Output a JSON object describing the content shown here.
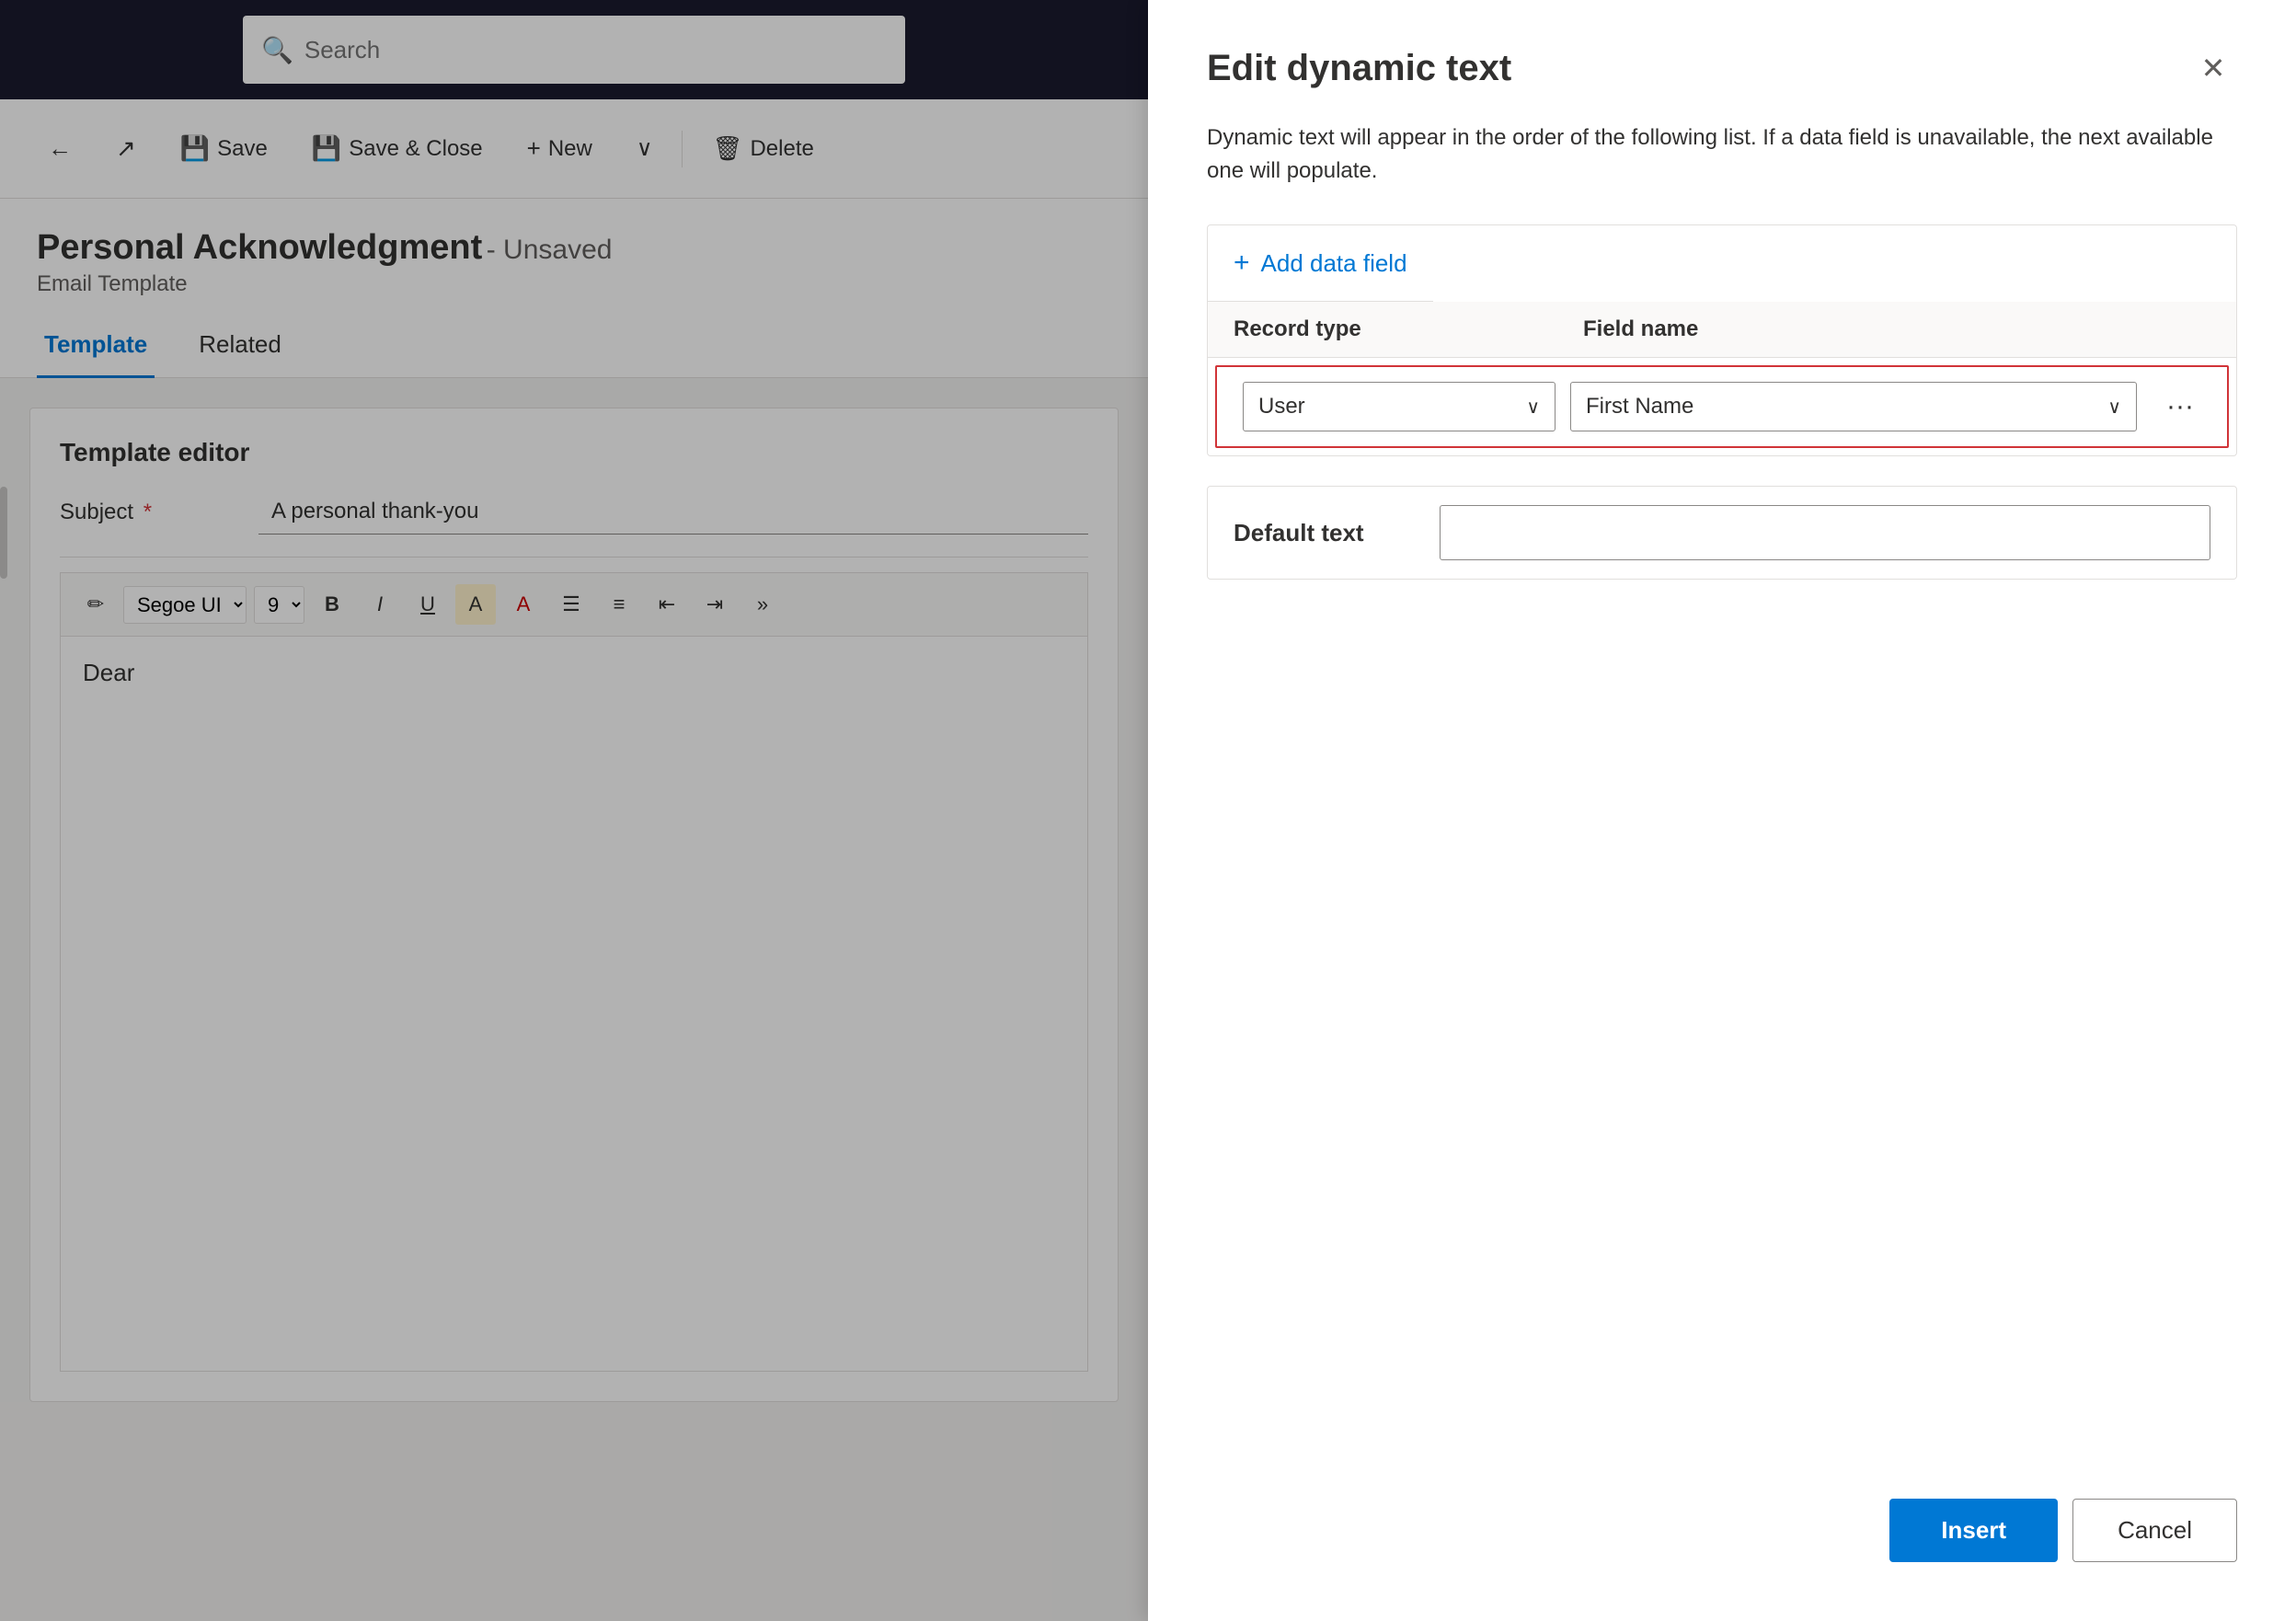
{
  "topnav": {
    "search_placeholder": "Search"
  },
  "commandbar": {
    "back_label": "Back",
    "save_label": "Save",
    "save_close_label": "Save & Close",
    "new_label": "New",
    "delete_label": "Delete"
  },
  "page": {
    "title": "Personal Acknowledgment",
    "title_suffix": " - Unsaved",
    "subtitle": "Email Template"
  },
  "tabs": [
    {
      "label": "Template",
      "active": true
    },
    {
      "label": "Related",
      "active": false
    }
  ],
  "template_editor": {
    "heading": "Template editor",
    "subject_label": "Subject",
    "subject_value": "A personal thank-you",
    "font_name": "Segoe UI",
    "font_size": "9",
    "editor_content": "Dear"
  },
  "toolbar": {
    "items": [
      "🖊",
      "B",
      "I",
      "U",
      "A",
      "≡",
      "☰",
      "⇤",
      "⇥",
      "»"
    ]
  },
  "modal": {
    "title": "Edit dynamic text",
    "description": "Dynamic text will appear in the order of the following list. If a data field is unavailable, the next available one will populate.",
    "add_field_label": "Add data field",
    "table": {
      "col_record": "Record type",
      "col_field": "Field name",
      "row": {
        "record_value": "User",
        "field_value": "First Name"
      }
    },
    "default_text_label": "Default text",
    "default_text_placeholder": "",
    "insert_label": "Insert",
    "cancel_label": "Cancel"
  }
}
